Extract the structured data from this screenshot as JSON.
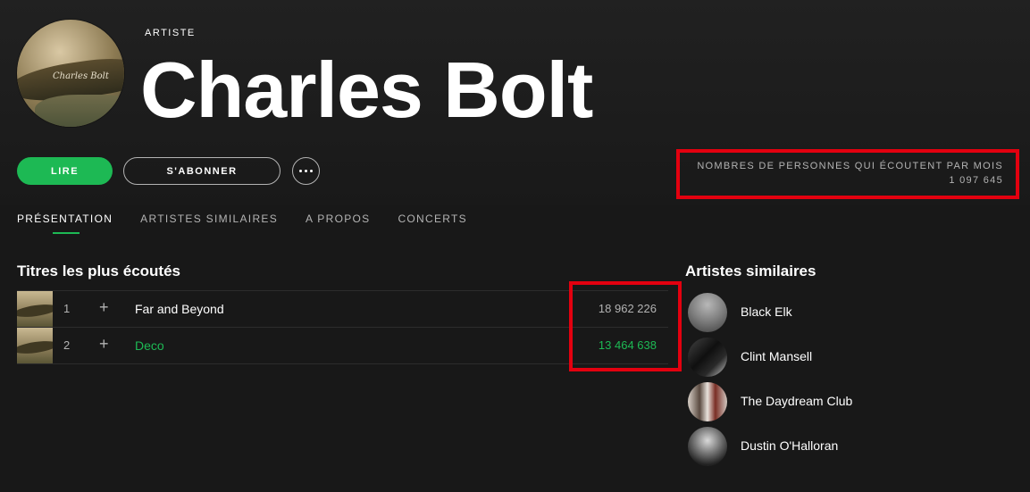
{
  "header": {
    "kind": "ARTISTE",
    "artist_name": "Charles Bolt",
    "cover_signature": "Charles Bolt"
  },
  "actions": {
    "play_label": "LIRE",
    "follow_label": "S'ABONNER",
    "more_icon": "more-horizontal-icon"
  },
  "listeners": {
    "label": "NOMBRES DE PERSONNES QUI ÉCOUTENT PAR MOIS",
    "value": "1 097 645"
  },
  "tabs": [
    {
      "label": "PRÉSENTATION",
      "active": true
    },
    {
      "label": "ARTISTES SIMILAIRES",
      "active": false
    },
    {
      "label": "A PROPOS",
      "active": false
    },
    {
      "label": "CONCERTS",
      "active": false
    }
  ],
  "popular": {
    "title": "Titres les plus écoutés",
    "tracks": [
      {
        "number": "1",
        "add": "+",
        "title": "Far and Beyond",
        "plays": "18 962 226"
      },
      {
        "number": "2",
        "add": "+",
        "title": "Deco",
        "plays": "13 464 638"
      }
    ]
  },
  "related": {
    "title": "Artistes similaires",
    "artists": [
      {
        "name": "Black Elk"
      },
      {
        "name": "Clint Mansell"
      },
      {
        "name": "The Daydream Club"
      },
      {
        "name": "Dustin O'Halloran"
      }
    ]
  },
  "colors": {
    "background": "#181818",
    "accent": "#1db954",
    "highlight_box": "#e3000f",
    "muted_text": "#b3b3b3"
  }
}
